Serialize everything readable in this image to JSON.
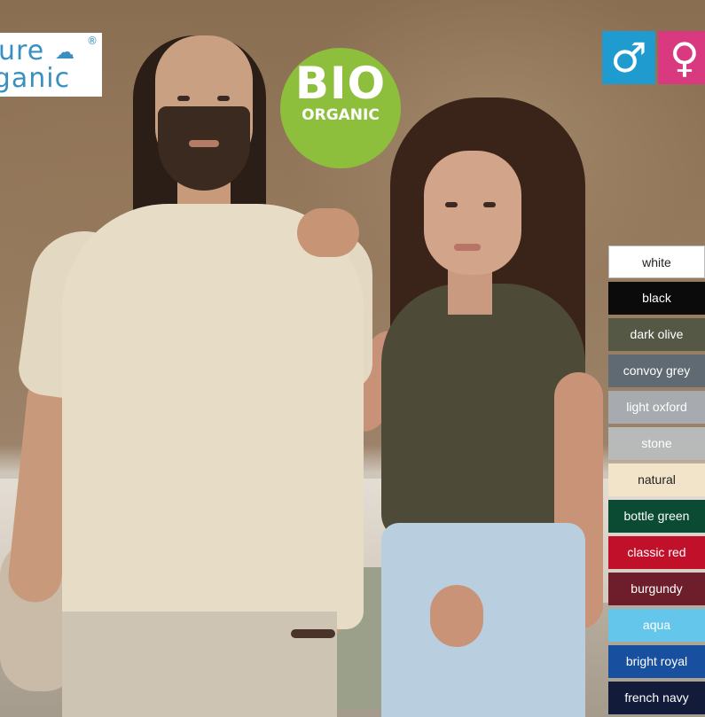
{
  "logos": {
    "pure_organic_line1": "ure",
    "pure_organic_line2": "rganic",
    "pure_organic_registered": "®",
    "bio_main": "BIO",
    "bio_sub": "ORGANIC"
  },
  "gender_icons": {
    "male_symbol": "♂",
    "female_symbol": "♀",
    "male_color": "#1f9bd0",
    "female_color": "#d8397f"
  },
  "colors": [
    {
      "label": "white",
      "hex": "#ffffff"
    },
    {
      "label": "black",
      "hex": "#0b0b0b"
    },
    {
      "label": "dark olive",
      "hex": "#565846"
    },
    {
      "label": "convoy grey",
      "hex": "#5f6a73"
    },
    {
      "label": "light oxford",
      "hex": "#a7aaae"
    },
    {
      "label": "stone",
      "hex": "#b8b9b9"
    },
    {
      "label": "natural",
      "hex": "#f2e4c8"
    },
    {
      "label": "bottle green",
      "hex": "#0b4a33"
    },
    {
      "label": "classic red",
      "hex": "#c0102a"
    },
    {
      "label": "burgundy",
      "hex": "#6e1d2a"
    },
    {
      "label": "aqua",
      "hex": "#63c6ea"
    },
    {
      "label": "bright royal",
      "hex": "#18509f"
    },
    {
      "label": "french navy",
      "hex": "#121c3a"
    }
  ]
}
